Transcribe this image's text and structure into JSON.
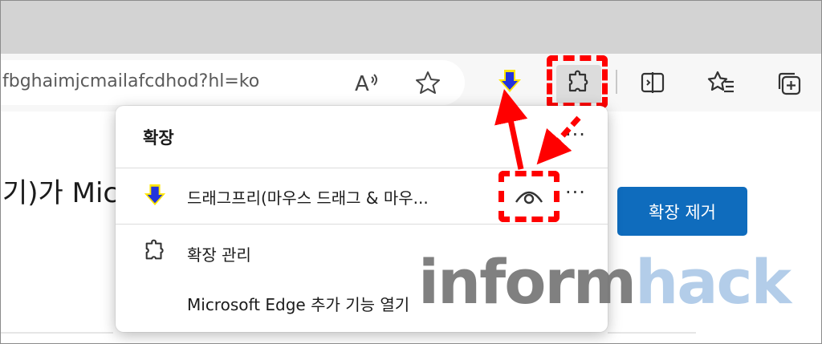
{
  "browser": {
    "address": {
      "url_text": "fbghaimjcmailafcdhod?hl=ko"
    },
    "toolbar_icons": [
      "read-aloud-icon",
      "favorite-star-icon",
      "dragfree-extension-icon",
      "extensions-puzzle-icon",
      "split-screen-icon",
      "favorites-icon",
      "collections-icon"
    ]
  },
  "page": {
    "heading_fragment": "기)가 Mic",
    "remove_button_label": "확장 제거"
  },
  "extensions_panel": {
    "title": "확장",
    "more_label": "···",
    "extensions": [
      {
        "name": "드래그프리(마우스 드래그 & 마우...",
        "icon": "dragfree-arrow-icon",
        "more_label": "···"
      }
    ],
    "manage_label": "확장 관리",
    "addons_label": "Microsoft Edge 추가 기능 열기"
  },
  "watermark": {
    "part1": "inform",
    "part2": "hack"
  },
  "colors": {
    "annotation_red": "#ff0000",
    "accent_blue": "#0f6cbd",
    "dragfree_blue": "#2233dd",
    "dragfree_yellow": "#ffe600"
  }
}
